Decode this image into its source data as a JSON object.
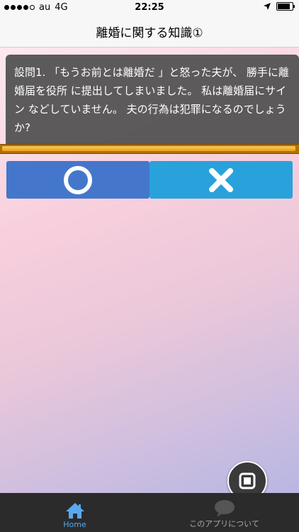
{
  "status": {
    "carrier": "au",
    "network": "4G",
    "time": "22:25"
  },
  "nav": {
    "title": "離婚に関する知識①"
  },
  "question": {
    "text": "設問1. 「もうお前とは離婚だ 」と怒った夫が、 勝手に離婚届を役所 に提出してしまいました。 私は離婚届にサイン などしていません。 夫の行為は犯罪になるのでしょうか?"
  },
  "progress": {
    "fraction": 0.98
  },
  "answers": {
    "true_icon": "circle-icon",
    "false_icon": "cross-icon"
  },
  "tabs": [
    {
      "label": "Home",
      "icon": "home-icon",
      "active": true
    },
    {
      "label": "このアプリについて",
      "icon": "speech-bubble-icon",
      "active": false
    }
  ],
  "colors": {
    "true_button": "#4477cc",
    "false_button": "#29a2db",
    "active_tab": "#5aa8f0"
  }
}
